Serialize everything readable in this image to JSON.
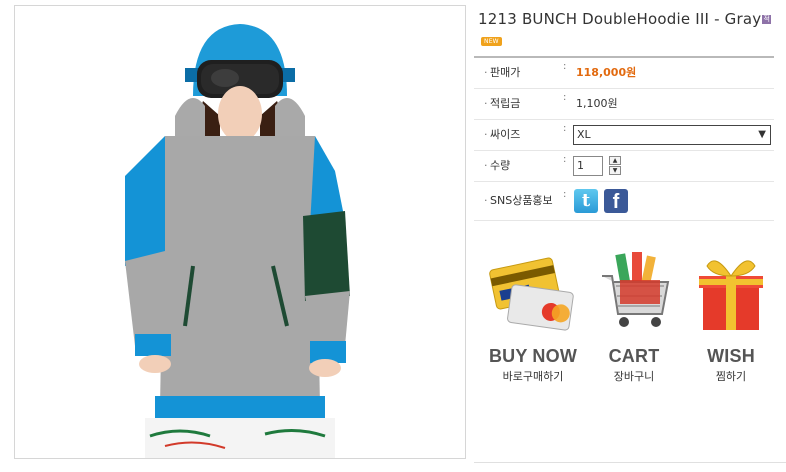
{
  "product": {
    "title": "1213 BUNCH DoubleHoodie III - Gray",
    "badge_jeok": "적",
    "badge_new": "NEW"
  },
  "info": {
    "bullet": "·",
    "colon": ":",
    "price_label": "판매가",
    "price_value": "118,000원",
    "points_label": "적립금",
    "points_value": "1,100원",
    "size_label": "싸이즈",
    "size_value": "XL",
    "qty_label": "수량",
    "qty_value": "1",
    "sns_label": "SNS상품홍보"
  },
  "icons": {
    "up": "▲",
    "down": "▼",
    "dropdown": "▼",
    "twitter": "t",
    "facebook": "f"
  },
  "actions": {
    "buy_en": "BUY NOW",
    "buy_ko": "바로구매하기",
    "cart_en": "CART",
    "cart_ko": "장바구니",
    "wish_en": "WISH",
    "wish_ko": "찜하기"
  },
  "colors": {
    "price": "#e26a0f",
    "hoodie_blue": "#1493d6",
    "hoodie_gray": "#a9a9a9",
    "facebook": "#3b5998",
    "twitter": "#33aee6"
  }
}
